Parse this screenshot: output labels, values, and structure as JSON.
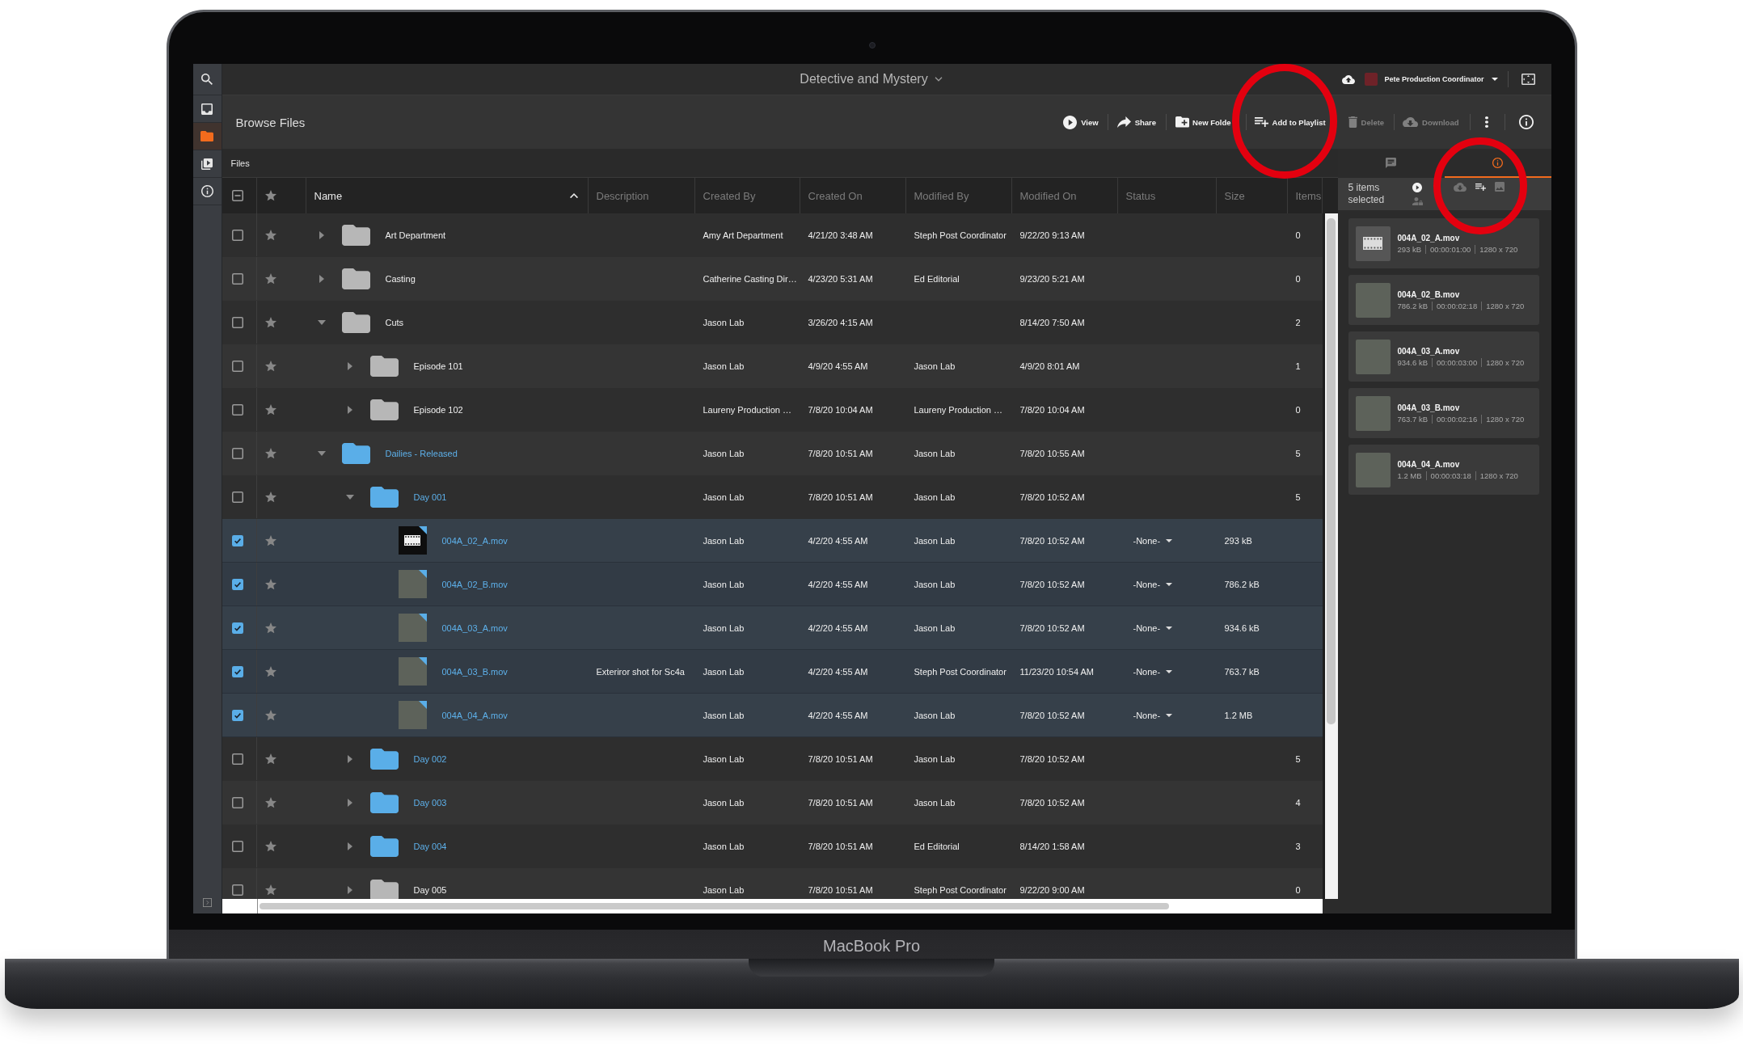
{
  "device": {
    "label": "MacBook Pro"
  },
  "nav": [
    {
      "kind": "search",
      "selected": false
    },
    {
      "kind": "inbox",
      "selected": false
    },
    {
      "kind": "files",
      "selected": true
    },
    {
      "kind": "media",
      "selected": false
    },
    {
      "kind": "info",
      "selected": false
    }
  ],
  "top_bar": {
    "project_title": "Detective and Mystery",
    "user_name": "Pete Production Coordinator"
  },
  "toolbar": {
    "title": "Browse Files",
    "actions": [
      {
        "kind": "view",
        "label": "View",
        "disabled": false
      },
      {
        "kind": "share",
        "label": "Share",
        "disabled": false
      },
      {
        "kind": "new-folder",
        "label": "New Folde",
        "disabled": false
      },
      {
        "kind": "add-to-playlist",
        "label": "Add to Playlist",
        "disabled": false
      },
      {
        "kind": "delete",
        "label": "Delete",
        "disabled": true
      },
      {
        "kind": "download",
        "label": "Download",
        "disabled": true
      }
    ],
    "icon_buttons": [
      {
        "kind": "more"
      },
      {
        "kind": "info"
      }
    ]
  },
  "breadcrumb": "Files",
  "table": {
    "select_all": {
      "partial": true
    },
    "columns": [
      {
        "label": "Name",
        "sorted": true
      },
      {
        "label": "Description",
        "sorted": false
      },
      {
        "label": "Created By",
        "sorted": false
      },
      {
        "label": "Created On",
        "sorted": false
      },
      {
        "label": "Modified By",
        "sorted": false
      },
      {
        "label": "Modified On",
        "sorted": false
      },
      {
        "label": "Status",
        "sorted": false
      },
      {
        "label": "Size",
        "sorted": false
      },
      {
        "label": "Items",
        "sorted": false
      }
    ],
    "rows": [
      {
        "kind": "folder",
        "name": "Art Department",
        "selected": false,
        "expanded": false,
        "highlighted": false,
        "created_by": "Amy Art Department",
        "created_on": "4/21/20 3:48 AM",
        "modified_by": "Steph Post Coordinator",
        "modified_on": "9/22/20 9:13 AM",
        "items": "0"
      },
      {
        "kind": "folder",
        "name": "Casting",
        "selected": false,
        "expanded": false,
        "highlighted": false,
        "created_by": "Catherine Casting Dir…",
        "created_on": "4/23/20 5:31 AM",
        "modified_by": "Ed Editorial",
        "modified_on": "9/23/20 5:21 AM",
        "items": "0"
      },
      {
        "kind": "folder",
        "name": "Cuts",
        "selected": false,
        "expanded": true,
        "highlighted": false,
        "created_by": "Jason Lab",
        "created_on": "3/26/20 4:15 AM",
        "modified_on": "8/14/20 7:50 AM",
        "items": "2",
        "children": [
          {
            "kind": "folder",
            "name": "Episode 101",
            "selected": false,
            "expanded": false,
            "highlighted": false,
            "created_by": "Jason Lab",
            "created_on": "4/9/20 4:55 AM",
            "modified_by": "Jason Lab",
            "modified_on": "4/9/20 8:01 AM",
            "items": "1"
          },
          {
            "kind": "folder",
            "name": "Episode 102",
            "selected": false,
            "expanded": false,
            "highlighted": false,
            "created_by": "Laureny Production …",
            "created_on": "7/8/20 10:04 AM",
            "modified_by": "Laureny Production …",
            "modified_on": "7/8/20 10:04 AM",
            "items": "0"
          }
        ]
      },
      {
        "kind": "folder",
        "name": "Dailies - Released",
        "selected": false,
        "expanded": true,
        "highlighted": true,
        "created_by": "Jason Lab",
        "created_on": "7/8/20 10:51 AM",
        "modified_by": "Jason Lab",
        "modified_on": "7/8/20 10:55 AM",
        "items": "5",
        "children": [
          {
            "kind": "folder",
            "name": "Day 001",
            "selected": false,
            "expanded": true,
            "highlighted": true,
            "created_by": "Jason Lab",
            "created_on": "7/8/20 10:51 AM",
            "modified_by": "Jason Lab",
            "modified_on": "7/8/20 10:52 AM",
            "items": "5",
            "children": [
              {
                "kind": "file",
                "name": "004A_02_A.mov",
                "thumbnail": {
                  "kind": "film"
                },
                "selected": true,
                "highlighted": true,
                "created_by": "Jason Lab",
                "created_on": "4/2/20 4:55 AM",
                "modified_by": "Jason Lab",
                "modified_on": "7/8/20 10:52 AM",
                "status": "-None-",
                "size": "293 kB"
              },
              {
                "kind": "file",
                "name": "004A_02_B.mov",
                "thumbnail": {
                  "kind": "photo"
                },
                "selected": true,
                "highlighted": true,
                "created_by": "Jason Lab",
                "created_on": "4/2/20 4:55 AM",
                "modified_by": "Jason Lab",
                "modified_on": "7/8/20 10:52 AM",
                "status": "-None-",
                "size": "786.2 kB"
              },
              {
                "kind": "file",
                "name": "004A_03_A.mov",
                "thumbnail": {
                  "kind": "photo"
                },
                "selected": true,
                "highlighted": true,
                "created_by": "Jason Lab",
                "created_on": "4/2/20 4:55 AM",
                "modified_by": "Jason Lab",
                "modified_on": "7/8/20 10:52 AM",
                "status": "-None-",
                "size": "934.6 kB"
              },
              {
                "kind": "file",
                "name": "004A_03_B.mov",
                "thumbnail": {
                  "kind": "photo"
                },
                "selected": true,
                "highlighted": true,
                "description": "Exteriror shot for Sc4a",
                "created_by": "Jason Lab",
                "created_on": "4/2/20 4:55 AM",
                "modified_by": "Steph Post Coordinator",
                "modified_on": "11/23/20 10:54 AM",
                "status": "-None-",
                "size": "763.7 kB"
              },
              {
                "kind": "file",
                "name": "004A_04_A.mov",
                "thumbnail": {
                  "kind": "photo"
                },
                "selected": true,
                "highlighted": true,
                "created_by": "Jason Lab",
                "created_on": "4/2/20 4:55 AM",
                "modified_by": "Jason Lab",
                "modified_on": "7/8/20 10:52 AM",
                "status": "-None-",
                "size": "1.2 MB"
              }
            ]
          },
          {
            "kind": "folder",
            "name": "Day 002",
            "selected": false,
            "expanded": false,
            "highlighted": true,
            "created_by": "Jason Lab",
            "created_on": "7/8/20 10:51 AM",
            "modified_by": "Jason Lab",
            "modified_on": "7/8/20 10:52 AM",
            "items": "5"
          },
          {
            "kind": "folder",
            "name": "Day 003",
            "selected": false,
            "expanded": false,
            "highlighted": true,
            "created_by": "Jason Lab",
            "created_on": "7/8/20 10:51 AM",
            "modified_by": "Jason Lab",
            "modified_on": "7/8/20 10:52 AM",
            "items": "4"
          },
          {
            "kind": "folder",
            "name": "Day 004",
            "selected": false,
            "expanded": false,
            "highlighted": true,
            "created_by": "Jason Lab",
            "created_on": "7/8/20 10:51 AM",
            "modified_by": "Ed Editorial",
            "modified_on": "8/14/20 1:58 AM",
            "items": "3"
          },
          {
            "kind": "folder",
            "name": "Day 005",
            "selected": false,
            "expanded": false,
            "highlighted": false,
            "created_by": "Jason Lab",
            "created_on": "7/8/20 10:51 AM",
            "modified_by": "Steph Post Coordinator",
            "modified_on": "9/22/20 9:00 AM",
            "items": "0"
          }
        ]
      }
    ]
  },
  "side_panel": {
    "tabs": [
      {
        "kind": "comments",
        "selected": false
      },
      {
        "kind": "info",
        "selected": true
      }
    ],
    "selection_label": "5 items selected",
    "actions": [
      {
        "kind": "play",
        "disabled": false
      },
      {
        "kind": "user-lock",
        "disabled": true
      },
      {
        "kind": "download",
        "disabled": true
      },
      {
        "kind": "add-to-playlist",
        "disabled": false
      },
      {
        "kind": "image",
        "disabled": true
      }
    ],
    "items": [
      {
        "name": "004A_02_A.mov",
        "size": "293 kB",
        "duration": "00:00:01:00",
        "resolution": "1280 x 720",
        "thumbnail": {
          "kind": "film"
        }
      },
      {
        "name": "004A_02_B.mov",
        "size": "786.2 kB",
        "duration": "00:00:02:18",
        "resolution": "1280 x 720",
        "thumbnail": {
          "kind": "photo"
        }
      },
      {
        "name": "004A_03_A.mov",
        "size": "934.6 kB",
        "duration": "00:00:03:00",
        "resolution": "1280 x 720",
        "thumbnail": {
          "kind": "photo"
        }
      },
      {
        "name": "004A_03_B.mov",
        "size": "763.7 kB",
        "duration": "00:00:02:16",
        "resolution": "1280 x 720",
        "thumbnail": {
          "kind": "photo"
        }
      },
      {
        "name": "004A_04_A.mov",
        "size": "1.2 MB",
        "duration": "00:00:03:18",
        "resolution": "1280 x 720",
        "thumbnail": {
          "kind": "photo"
        }
      }
    ]
  },
  "annotations": [
    {
      "kind": "circle"
    },
    {
      "kind": "circle"
    }
  ]
}
